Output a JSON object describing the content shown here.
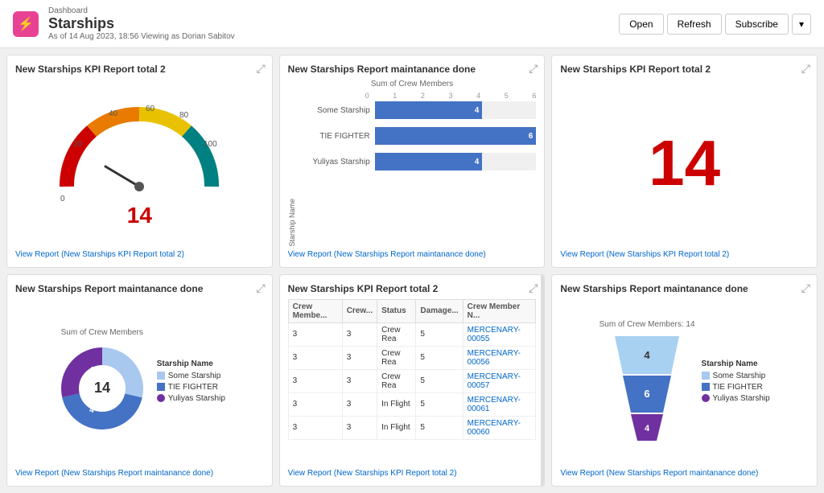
{
  "header": {
    "breadcrumb": "Dashboard",
    "title": "Starships",
    "subtitle": "As of 14 Aug 2023, 18:56 Viewing as Dorian Sabitov",
    "logo_icon": "⚡",
    "buttons": {
      "open": "Open",
      "refresh": "Refresh",
      "subscribe": "Subscribe"
    }
  },
  "cards": {
    "gauge_kpi": {
      "title": "New Starships KPI Report total 2",
      "value": "14",
      "link": "View Report (New Starships KPI Report total 2)"
    },
    "bar_maintenance": {
      "title": "New Starships Report maintanance done",
      "axis_label": "Sum of Crew Members",
      "y_axis_label": "Starship Name",
      "axis_numbers": [
        "0",
        "1",
        "2",
        "3",
        "4",
        "5",
        "6"
      ],
      "bars": [
        {
          "label": "Some Starship",
          "value": 4,
          "max": 6
        },
        {
          "label": "TIE FIGHTER",
          "value": 6,
          "max": 6
        },
        {
          "label": "Yuliyas Starship",
          "value": 4,
          "max": 6
        }
      ],
      "link": "View Report (New Starships Report maintanance done)"
    },
    "big_number_kpi": {
      "title": "New Starships KPI Report total 2",
      "value": "14",
      "link": "View Report (New Starships KPI Report total 2)"
    },
    "donut_maintenance": {
      "title": "New Starships Report maintanance done",
      "chart_title": "Sum of Crew Members",
      "center_value": "14",
      "legend": [
        {
          "label": "Some Starship",
          "color": "#a8c8f0",
          "type": "square"
        },
        {
          "label": "TIE FIGHTER",
          "color": "#4472c4",
          "type": "square"
        },
        {
          "label": "Yuliyas Starship",
          "color": "#7030a0",
          "type": "circle"
        }
      ],
      "segments": [
        {
          "value": 4,
          "color": "#a8c8f0"
        },
        {
          "value": 6,
          "color": "#4472c4"
        },
        {
          "value": 4,
          "color": "#7030a0"
        }
      ],
      "link": "View Report (New Starships Report maintanance done)"
    },
    "table_kpi": {
      "title": "New Starships KPI Report total 2",
      "columns": [
        "Crew Membe...",
        "Crew...",
        "Status",
        "Damage...",
        "Crew Member N..."
      ],
      "rows": [
        {
          "crew_members": "3",
          "crew": "3",
          "status": "Crew Rea",
          "damage": "5",
          "name": "MERCENARY-00055"
        },
        {
          "crew_members": "3",
          "crew": "3",
          "status": "Crew Rea",
          "damage": "5",
          "name": "MERCENARY-00056"
        },
        {
          "crew_members": "3",
          "crew": "3",
          "status": "Crew Rea",
          "damage": "5",
          "name": "MERCENARY-00057"
        },
        {
          "crew_members": "3",
          "crew": "3",
          "status": "In Flight",
          "damage": "5",
          "name": "MERCENARY-00061"
        },
        {
          "crew_members": "3",
          "crew": "3",
          "status": "In Flight",
          "damage": "5",
          "name": "MERCENARY-00060"
        }
      ],
      "link": "View Report (New Starships KPI Report total 2)"
    },
    "funnel_maintenance": {
      "title": "New Starships Report maintanance done",
      "chart_title": "Sum of Crew Members: 14",
      "legend_title": "Starship Name",
      "legend": [
        {
          "label": "Some Starship",
          "color": "#a8c8f0",
          "type": "square"
        },
        {
          "label": "TIE FIGHTER",
          "color": "#4472c4",
          "type": "square"
        },
        {
          "label": "Yuliyas Starship",
          "color": "#7030a0",
          "type": "circle"
        }
      ],
      "segments": [
        {
          "value": "4",
          "color": "#a8d0f0",
          "width_pct": 65
        },
        {
          "value": "6",
          "color": "#4472c4",
          "width_pct": 85
        },
        {
          "value": "4",
          "color": "#7030a0",
          "width_pct": 55
        }
      ],
      "link": "View Report (New Starships Report maintanance done)"
    }
  }
}
